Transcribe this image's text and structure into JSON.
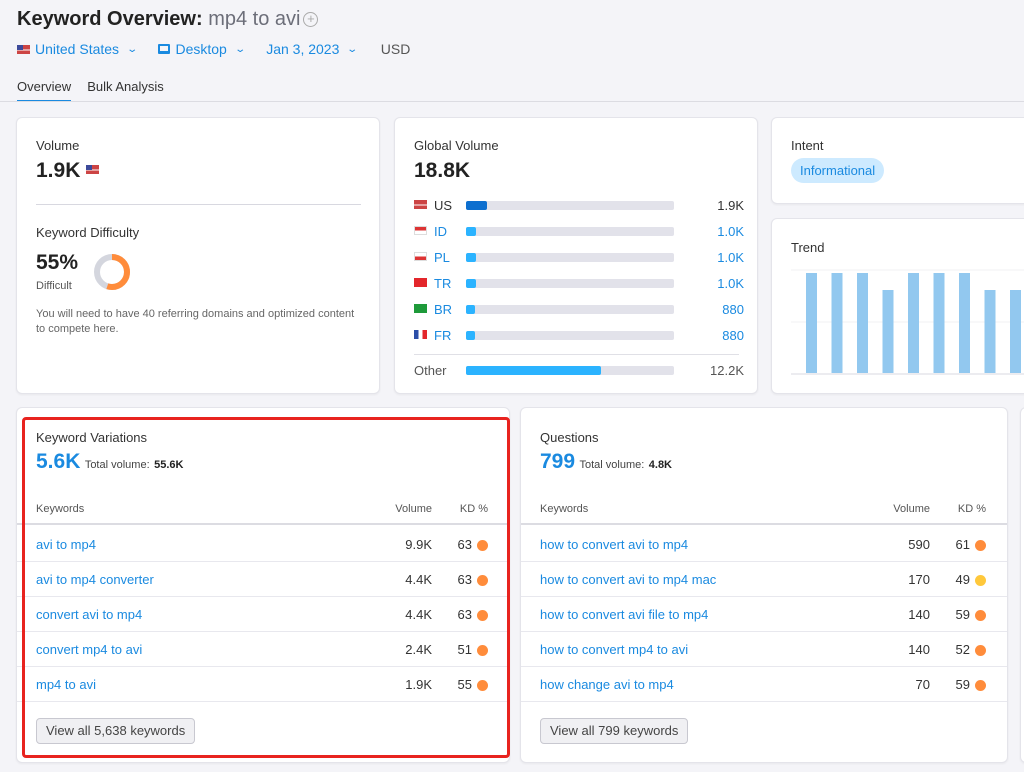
{
  "header": {
    "title": "Keyword Overview:",
    "keyword": "mp4 to avi",
    "add_icon": "plus-circle-icon",
    "filters": {
      "country": "United States",
      "device": "Desktop",
      "date": "Jan 3, 2023",
      "currency": "USD"
    }
  },
  "tabs": [
    {
      "label": "Overview",
      "active": true
    },
    {
      "label": "Bulk Analysis",
      "active": false
    }
  ],
  "volume": {
    "label": "Volume",
    "value": "1.9K",
    "flag": "us-flag-icon"
  },
  "difficulty": {
    "label": "Keyword Difficulty",
    "value": "55%",
    "level": "Difficult",
    "percent": 55,
    "color": "#ff8c3b",
    "note": "You will need to have 40 referring domains and optimized content to compete here."
  },
  "global_volume": {
    "label": "Global Volume",
    "value": "18.8K",
    "rows": [
      {
        "code": "US",
        "value": "1.9K",
        "fill": 0.1,
        "color": "#0d6fcf"
      },
      {
        "code": "ID",
        "value": "1.0K",
        "fill": 0.05,
        "color": "#2bb3ff"
      },
      {
        "code": "PL",
        "value": "1.0K",
        "fill": 0.05,
        "color": "#2bb3ff"
      },
      {
        "code": "TR",
        "value": "1.0K",
        "fill": 0.05,
        "color": "#2bb3ff"
      },
      {
        "code": "BR",
        "value": "880",
        "fill": 0.045,
        "color": "#2bb3ff"
      },
      {
        "code": "FR",
        "value": "880",
        "fill": 0.045,
        "color": "#2bb3ff"
      }
    ],
    "other": {
      "label": "Other",
      "value": "12.2K",
      "fill": 0.65
    }
  },
  "intent": {
    "label": "Intent",
    "value": "Informational"
  },
  "trend": {
    "label": "Trend",
    "values": [
      1,
      1,
      1,
      0.83,
      1,
      1,
      1,
      0.83,
      0.83,
      1
    ]
  },
  "variations": {
    "label": "Keyword Variations",
    "count": "5.6K",
    "total_label": "Total volume:",
    "total": "55.6K",
    "headers": {
      "keywords": "Keywords",
      "volume": "Volume",
      "kd": "KD %"
    },
    "rows": [
      {
        "keyword": "avi to mp4",
        "volume": "9.9K",
        "kd": "63",
        "kd_color": "#ff8c3b"
      },
      {
        "keyword": "avi to mp4 converter",
        "volume": "4.4K",
        "kd": "63",
        "kd_color": "#ff8c3b"
      },
      {
        "keyword": "convert avi to mp4",
        "volume": "4.4K",
        "kd": "63",
        "kd_color": "#ff8c3b"
      },
      {
        "keyword": "convert mp4 to avi",
        "volume": "2.4K",
        "kd": "51",
        "kd_color": "#ff8c3b"
      },
      {
        "keyword": "mp4 to avi",
        "volume": "1.9K",
        "kd": "55",
        "kd_color": "#ff8c3b"
      }
    ],
    "button": "View all 5,638 keywords",
    "highlight_color": "#e8231f"
  },
  "questions": {
    "label": "Questions",
    "count": "799",
    "total_label": "Total volume:",
    "total": "4.8K",
    "headers": {
      "keywords": "Keywords",
      "volume": "Volume",
      "kd": "KD %"
    },
    "rows": [
      {
        "keyword": "how to convert avi to mp4",
        "volume": "590",
        "kd": "61",
        "kd_color": "#ff8c3b"
      },
      {
        "keyword": "how to convert avi to mp4 mac",
        "volume": "170",
        "kd": "49",
        "kd_color": "#ffc83b"
      },
      {
        "keyword": "how to convert avi file to mp4",
        "volume": "140",
        "kd": "59",
        "kd_color": "#ff8c3b"
      },
      {
        "keyword": "how to convert mp4 to avi",
        "volume": "140",
        "kd": "52",
        "kd_color": "#ff8c3b"
      },
      {
        "keyword": "how change avi to mp4",
        "volume": "70",
        "kd": "59",
        "kd_color": "#ff8c3b"
      }
    ],
    "button": "View all 799 keywords"
  }
}
